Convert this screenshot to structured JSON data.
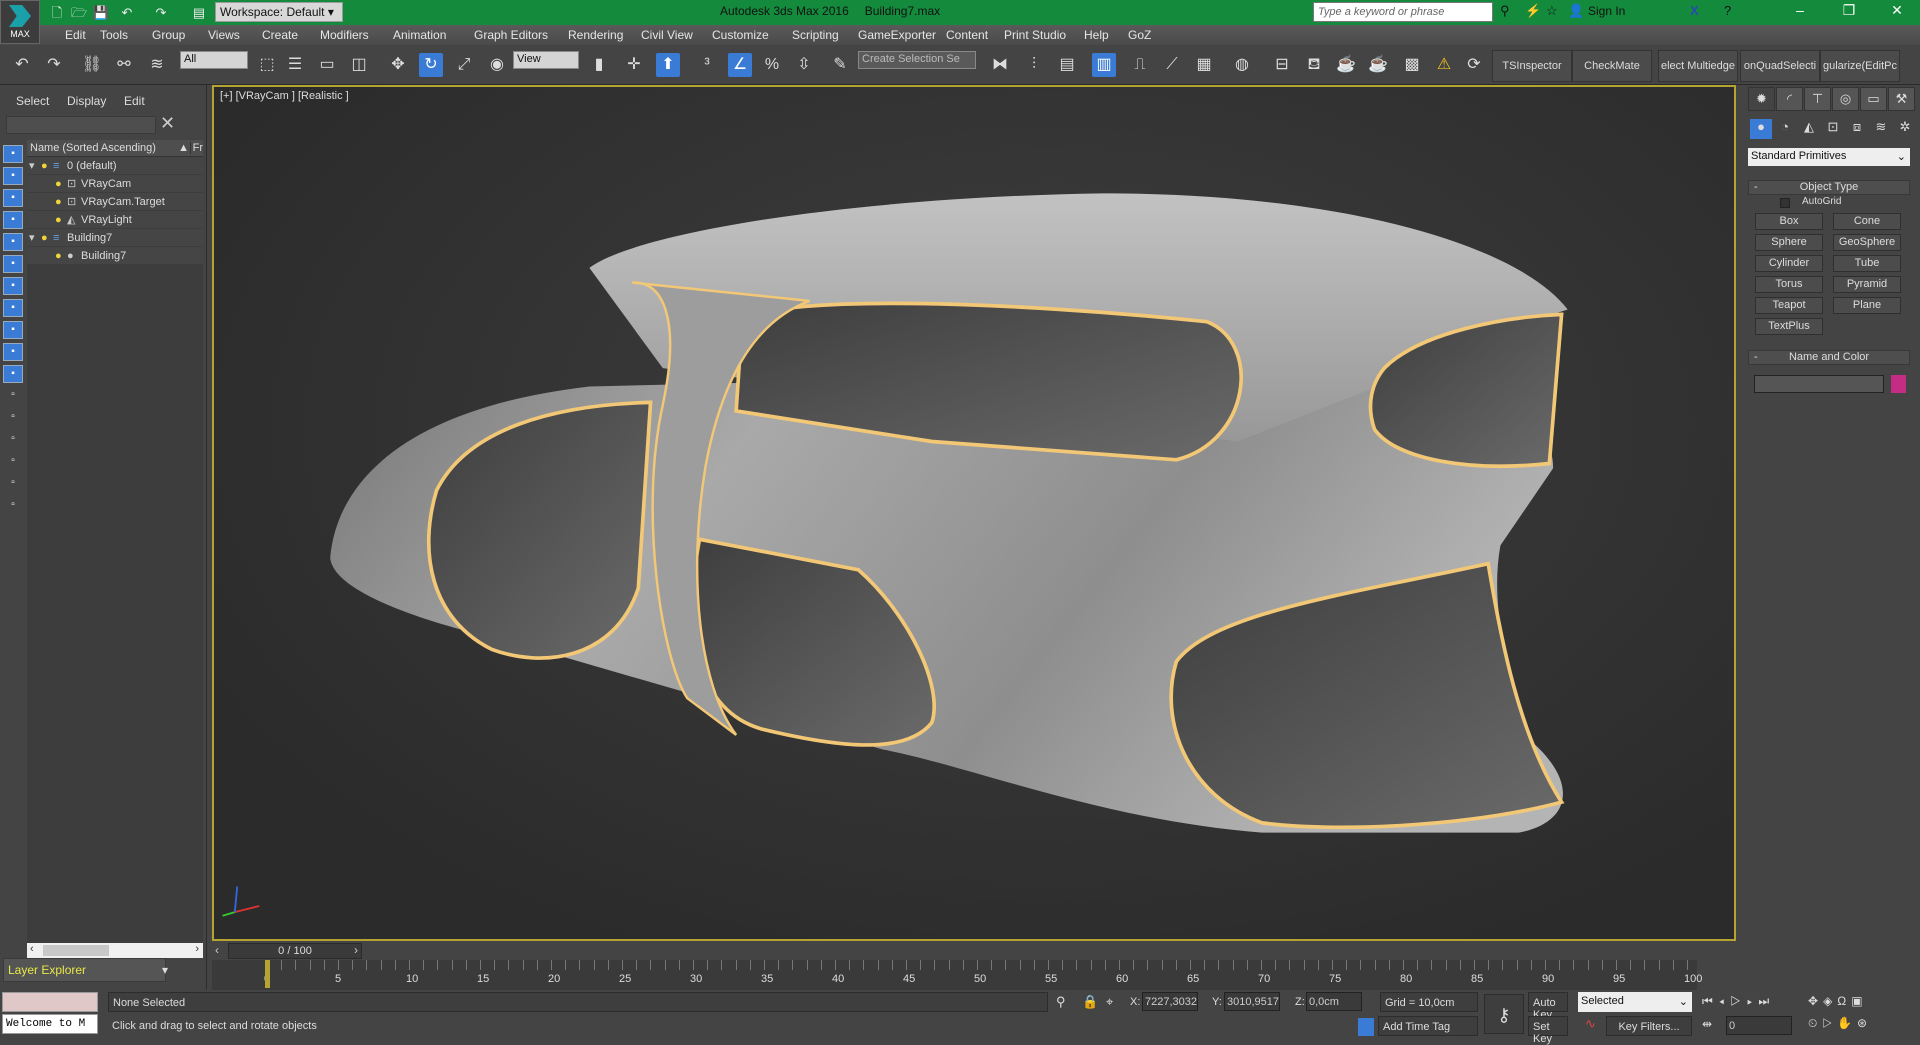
{
  "titlebar": {
    "app": "Autodesk 3ds Max 2016",
    "file": "Building7.max",
    "workspace": "Workspace: Default",
    "search_placeholder": "Type a keyword or phrase",
    "sign_in": "Sign In",
    "max_label": "MAX"
  },
  "menu": [
    "Edit",
    "Tools",
    "Group",
    "Views",
    "Create",
    "Modifiers",
    "Animation",
    "Graph Editors",
    "Rendering",
    "Civil View",
    "Customize",
    "Scripting",
    "GameExporter",
    "Content",
    "Print Studio",
    "Help",
    "GoZ"
  ],
  "toolbar": {
    "selection_filter": "All",
    "ref_coord": "View",
    "named_selection": "Create Selection Se",
    "plugins": [
      "TSInspector",
      "CheckMate",
      "elect Multiedge",
      "onQuadSelecti",
      "gularize(EditPc"
    ]
  },
  "scene_explorer": {
    "tabs": [
      "Select",
      "Display",
      "Edit"
    ],
    "column_header": "Name (Sorted Ascending)",
    "column_header2": "Fr",
    "items": [
      {
        "name": "0 (default)",
        "type": "layer",
        "level": 0
      },
      {
        "name": "VRayCam",
        "type": "camera",
        "level": 1
      },
      {
        "name": "VRayCam.Target",
        "type": "camera",
        "level": 1
      },
      {
        "name": "VRayLight",
        "type": "light",
        "level": 1
      },
      {
        "name": "Building7",
        "type": "layer",
        "level": 0
      },
      {
        "name": "Building7",
        "type": "geometry",
        "level": 1
      }
    ],
    "layer_explorer": "Layer Explorer"
  },
  "viewport": {
    "label": "[+] [VRayCam ] [Realistic ]"
  },
  "command_panel": {
    "category": "Standard Primitives",
    "object_type_title": "Object Type",
    "autogrid": "AutoGrid",
    "buttons": [
      "Box",
      "Cone",
      "Sphere",
      "GeoSphere",
      "Cylinder",
      "Tube",
      "Torus",
      "Pyramid",
      "Teapot",
      "Plane",
      "TextPlus"
    ],
    "name_color_title": "Name and Color",
    "object_color": "#c52c84"
  },
  "timeline": {
    "frame": "0 / 100",
    "current_frame": 0,
    "total_frames": 100,
    "labels": [
      "0",
      "5",
      "10",
      "15",
      "20",
      "25",
      "30",
      "35",
      "40",
      "45",
      "50",
      "55",
      "60",
      "65",
      "70",
      "75",
      "80",
      "85",
      "90",
      "95",
      "100"
    ]
  },
  "status": {
    "selection": "None Selected",
    "prompt": "Click and drag to select and rotate objects",
    "x_label": "X:",
    "x": "7227,3032",
    "y_label": "Y:",
    "y": "3010,9517",
    "z_label": "Z:",
    "z": "0,0cm",
    "grid": "Grid = 10,0cm",
    "add_time_tag": "Add Time Tag",
    "auto_key": "Auto Key",
    "set_key": "Set Key",
    "key_mode": "Selected",
    "key_filters": "Key Filters...",
    "frame_field": "0",
    "maxscript": "Welcome to M"
  }
}
